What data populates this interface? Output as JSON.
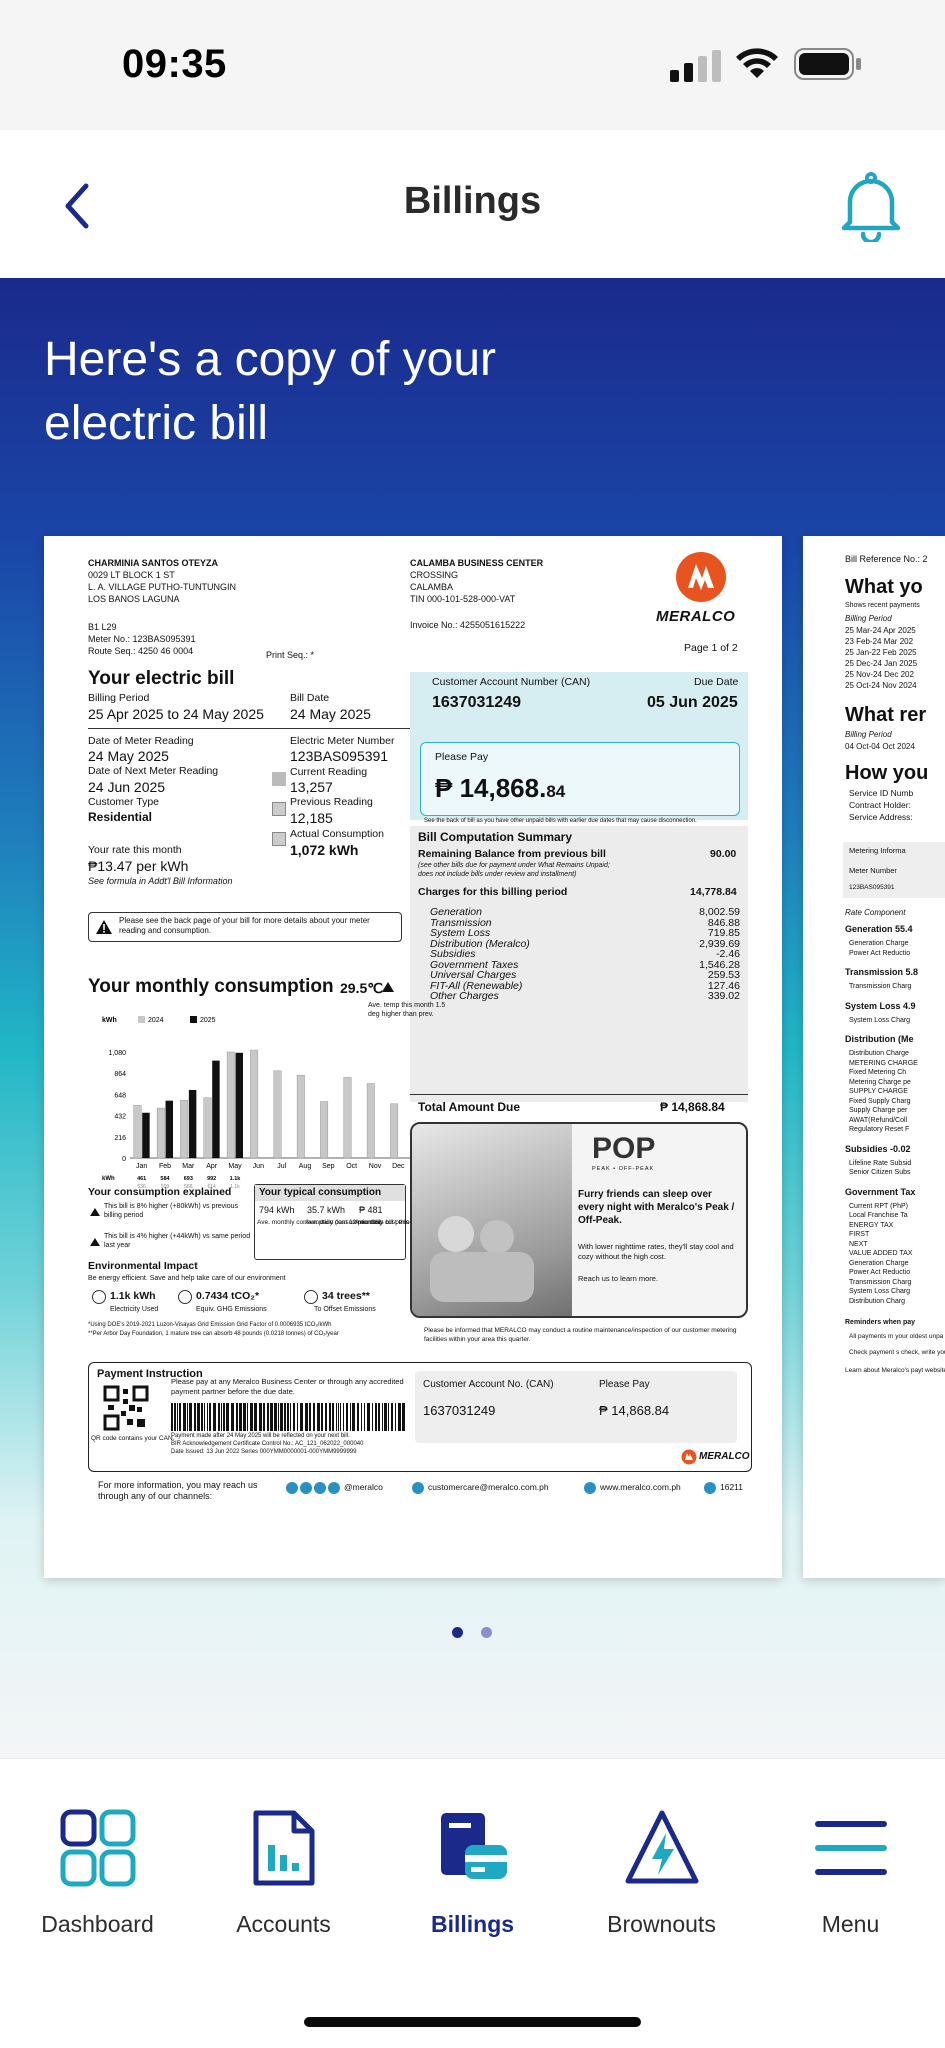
{
  "status_bar": {
    "time": "09:35"
  },
  "header": {
    "title": "Billings"
  },
  "hero": {
    "title": "Here's a copy of your electric bill"
  },
  "bill": {
    "customer_name": "CHARMINIA SANTOS OTEYZA",
    "address_line1": "0029 LT BLOCK 1 ST",
    "address_line2": "L. A. VILLAGE PUTHO-TUNTUNGIN",
    "address_line3": "LOS BANOS  LAGUNA",
    "b1": "B1 L29",
    "meter_no": "Meter No.: 123BAS095391",
    "route_seq": "Route Seq.: 4250 46 0004",
    "print_seq": "Print Seq.: *",
    "business_center_1": "CALAMBA BUSINESS CENTER",
    "business_center_2": "CROSSING",
    "business_center_3": "CALAMBA",
    "tin": "TIN 000-101-528-000-VAT",
    "invoice_no": "Invoice No.: 4255051615222",
    "logo_text": "MERALCO",
    "page": "Page 1 of 2",
    "your_bill_title": "Your electric bill",
    "billing_period_label": "Billing Period",
    "billing_period": "25 Apr 2025 to 24 May 2025",
    "bill_date_label": "Bill Date",
    "bill_date": "24 May 2025",
    "date_meter_label": "Date of Meter Reading",
    "date_meter": "24 May 2025",
    "next_meter_label": "Date of Next Meter Reading",
    "next_meter": "24 Jun 2025",
    "customer_type_label": "Customer Type",
    "customer_type": "Residential",
    "emn_label": "Electric Meter Number",
    "emn": "123BAS095391",
    "current_reading_label": "Current Reading",
    "current_reading": "13,257",
    "previous_reading_label": "Previous Reading",
    "previous_reading": "12,185",
    "actual_consumption_label": "Actual Consumption",
    "actual_consumption": "1,072 kWh",
    "rate_label": "Your rate this month",
    "rate": "₱13.47 per kWh",
    "rate_note": "See formula in Addt'l Bill Information",
    "notice": "Please see the back page of your bill for more details about your meter reading and consumption.",
    "can_label": "Customer Account Number (CAN)",
    "can": "1637031249",
    "due_label": "Due Date",
    "due": "05 Jun 2025",
    "please_pay_label": "Please Pay",
    "amount_main": "₱ 14,868.",
    "amount_cents": "84",
    "unpaid_note": "See the back of bill as you have other unpaid bills with earlier due dates that may cause disconnection.",
    "summary_title": "Bill Computation Summary",
    "remaining_label": "Remaining Balance from previous bill",
    "remaining_value": "90.00",
    "remaining_note1": "(see other bills due for payment under What Remains Unpaid;",
    "remaining_note2": "does not include bills under review and installment)",
    "charges_label": "Charges for this billing period",
    "charges_value": "14,778.84",
    "charges": [
      {
        "label": "Generation",
        "value": "8,002.59"
      },
      {
        "label": "Transmission",
        "value": "846.88"
      },
      {
        "label": "System Loss",
        "value": "719.85"
      },
      {
        "label": "Distribution (Meralco)",
        "value": "2,939.69"
      },
      {
        "label": "Subsidies",
        "value": "-2.46"
      },
      {
        "label": "Government Taxes",
        "value": "1,546.28"
      },
      {
        "label": "Universal Charges",
        "value": "259.53"
      },
      {
        "label": "FIT-All (Renewable)",
        "value": "127.46"
      },
      {
        "label": "Other Charges",
        "value": "339.02"
      }
    ],
    "total_label": "Total Amount Due",
    "total_value": "₱ 14,868.84",
    "monthly_title": "Your monthly consumption",
    "monthly_temp": "29.5℃",
    "monthly_temp_note1": "Ave. temp this month 1.5",
    "monthly_temp_note2": "deg higher than prev.",
    "explained_title": "Your consumption explained",
    "explained_1": "This bill is 8% higher (+80kWh) vs previous billing period",
    "explained_2": "This bill is 4% higher (+44kWh) vs same period last year",
    "typical_title": "Your typical consumption",
    "typical_v1": "794 kWh",
    "typical_v2": "35.7 kWh",
    "typical_v3": "₱ 481",
    "typical_l1": "Ave. monthly consumption (last 12 months)",
    "typical_l2": "Ave. daily consumption this bill period",
    "typical_l3": "Ave. daily cost this bill period",
    "env_title": "Environmental Impact",
    "env_sub": "Be energy efficient. Save and help take care of our environment",
    "env_1v": "1.1k kWh",
    "env_1l": "Electricity Used",
    "env_2v": "0.7434 tCO₂*",
    "env_2l": "Equiv. GHG Emissions",
    "env_3v": "34 trees**",
    "env_3l": "To Offset Emissions",
    "env_foot1": "*Using DOE's 2019-2021 Luzon-Visayas Grid Emission Grid Factor of 0.0006935 tCO₂/kWh",
    "env_foot2": "**Per Arbor Day Foundation, 1 mature tree can absorb 48 pounds (0.0218 tonnes) of CO₂/year",
    "promo_brand": "POP",
    "promo_brand_sub": "PEAK • OFF-PEAK",
    "promo_title": "Furry friends can sleep over every night with Meralco's Peak / Off-Peak.",
    "promo_body": "With lower nighttime rates, they'll stay cool and cozy without the high cost.",
    "promo_cta": "Reach us to learn more.",
    "routine_note": "Please be informed that MERALCO may conduct a routine maintenance/inspection of our customer metering facilities within your area this quarter.",
    "pay_title": "Payment Instruction",
    "pay_text": "Please pay at any Meralco Business Center or through any accredited payment partner before the due date.",
    "qr_caption": "QR code contains your CAN.",
    "pay_fine1": "Payment made after 24 May 2025 will be reflected on your next bill.",
    "pay_fine2": "BIR Acknowledgement Certificate Control No.: AC_121_062022_000040",
    "pay_fine3": "Date Issued: 13 Jun 2022  Series 000YMM0000001-000YMM9999999",
    "stub_can_label": "Customer Account No. (CAN)",
    "stub_can": "1637031249",
    "stub_pay_label": "Please Pay",
    "stub_pay": "₱ 14,868.84",
    "footer_text": "For more information, you may reach us through any of our channels:",
    "footer_social": "@meralco",
    "footer_email": "customercare@meralco.com.ph",
    "footer_web": "www.meralco.com.ph",
    "footer_phone": "16211"
  },
  "chart_data": {
    "type": "bar",
    "title": "",
    "categories": [
      "Jan",
      "Feb",
      "Mar",
      "Apr",
      "May",
      "Jun",
      "Jul",
      "Aug",
      "Sep",
      "Oct",
      "Nov",
      "Dec"
    ],
    "series": [
      {
        "name": "2024",
        "values": [
          536,
          509,
          588,
          614,
          1080,
          1100,
          888,
          844,
          576,
          821,
          759,
          553
        ]
      },
      {
        "name": "2025",
        "values": [
          461,
          584,
          693,
          992,
          1072,
          null,
          null,
          null,
          null,
          null,
          null,
          null
        ]
      }
    ],
    "ylabel": "kWh",
    "yticks": [
      "1,080",
      "864",
      "648",
      "432",
      "216",
      "0"
    ],
    "ylim": [
      0,
      1080
    ],
    "row_label": "kWh",
    "row_2025": [
      "461",
      "584",
      "693",
      "992",
      "1.1k",
      "",
      "",
      "",
      "",
      "",
      "",
      ""
    ],
    "row_2024": [
      "536",
      "509",
      "588",
      "614",
      "1.1k",
      "888",
      "844",
      "576",
      "821",
      "759",
      "553",
      ""
    ],
    "legend": [
      "2024",
      "2025"
    ],
    "bar_colors": {
      "2024": "#c8c8c8",
      "2025": "#111111"
    }
  },
  "peek": {
    "ref": "Bill Reference No.: 2",
    "h1": "What yo",
    "note": "Shows recent payments",
    "bp": "Billing Period",
    "rows": [
      "25 Mar-24 Apr 2025",
      "23 Feb-24 Mar 202",
      "25 Jan-22 Feb 2025",
      "25 Dec-24 Jan 2025",
      "25 Nov-24 Dec 202",
      "25 Oct-24 Nov 2024"
    ],
    "h2": "What rer",
    "bp2": "Billing Period",
    "row2": "04 Oct-04 Oct 2024",
    "h3": "How you",
    "svc": [
      "Service ID Numb",
      "Contract Holder:",
      "Service Address:"
    ],
    "metering": "Metering Informa",
    "meter_number": "Meter Number",
    "meter_val": "123BAS095391",
    "rate_comp": "Rate Component",
    "gen": "Generation 55.4",
    "gen_items": [
      "Generation Charge",
      "Power Act Reductio"
    ],
    "trans": "Transmission 5.8",
    "trans_items": [
      "Transmission Charg"
    ],
    "sysloss": "System Loss 4.9",
    "sysloss_items": [
      "System Loss Charg"
    ],
    "dist": "Distribution (Me",
    "dist_items": [
      "Distribution Charge",
      "METERING CHARGE",
      "Fixed Metering Ch",
      "Metering Charge pe",
      "SUPPLY CHARGE",
      "Fixed Supply Charg",
      "Supply Charge per",
      "AWAT(Refund/Coll",
      "Regulatory Reset F"
    ],
    "subs": "Subsidies -0.02",
    "subs_items": [
      "Lifeline Rate Subsid",
      "Senior Citizen Subs"
    ],
    "gov": "Government Tax",
    "gov_items": [
      "Current RPT (PhP)",
      "Local Franchise Ta",
      "ENERGY TAX",
      "FIRST",
      "NEXT",
      "VALUE ADDED TAX",
      "Generation Charge",
      "Power Act Reductio",
      "Transmission Charg",
      "System Loss Charg",
      "Distribution Charg"
    ],
    "remind": "Reminders when pay",
    "remind1": "All payments m your oldest unpa any inconvenie",
    "remind2": "Check payment s check, write you",
    "learn": "Learn about Meralco's payt website or any of our socia"
  },
  "pagination": {
    "active": 0,
    "count": 2
  },
  "nav": {
    "items": [
      {
        "label": "Dashboard"
      },
      {
        "label": "Accounts"
      },
      {
        "label": "Billings"
      },
      {
        "label": "Brownouts"
      },
      {
        "label": "Menu"
      }
    ],
    "active_color": "#1b2a8a",
    "accent": "#1fa8c2"
  }
}
